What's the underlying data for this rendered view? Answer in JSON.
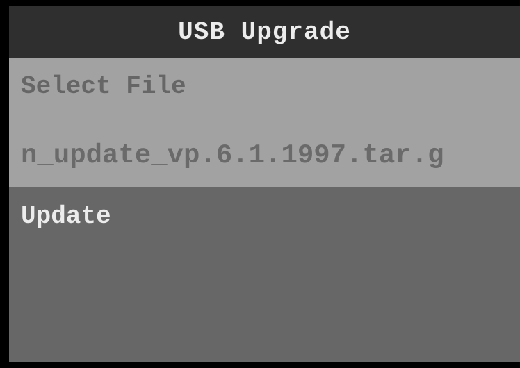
{
  "header": {
    "title": "USB Upgrade"
  },
  "menu": {
    "select_file": {
      "label": "Select File",
      "value": "n_update_vp.6.1.1997.tar.g"
    },
    "update": {
      "label": "Update"
    }
  },
  "colors": {
    "background": "#000000",
    "header_bg": "#2f2f2f",
    "selected_item_bg": "#a2a2a2",
    "item_bg": "#676767",
    "header_text": "#ececec",
    "selected_text": "#666666",
    "item_text": "#ececec"
  }
}
